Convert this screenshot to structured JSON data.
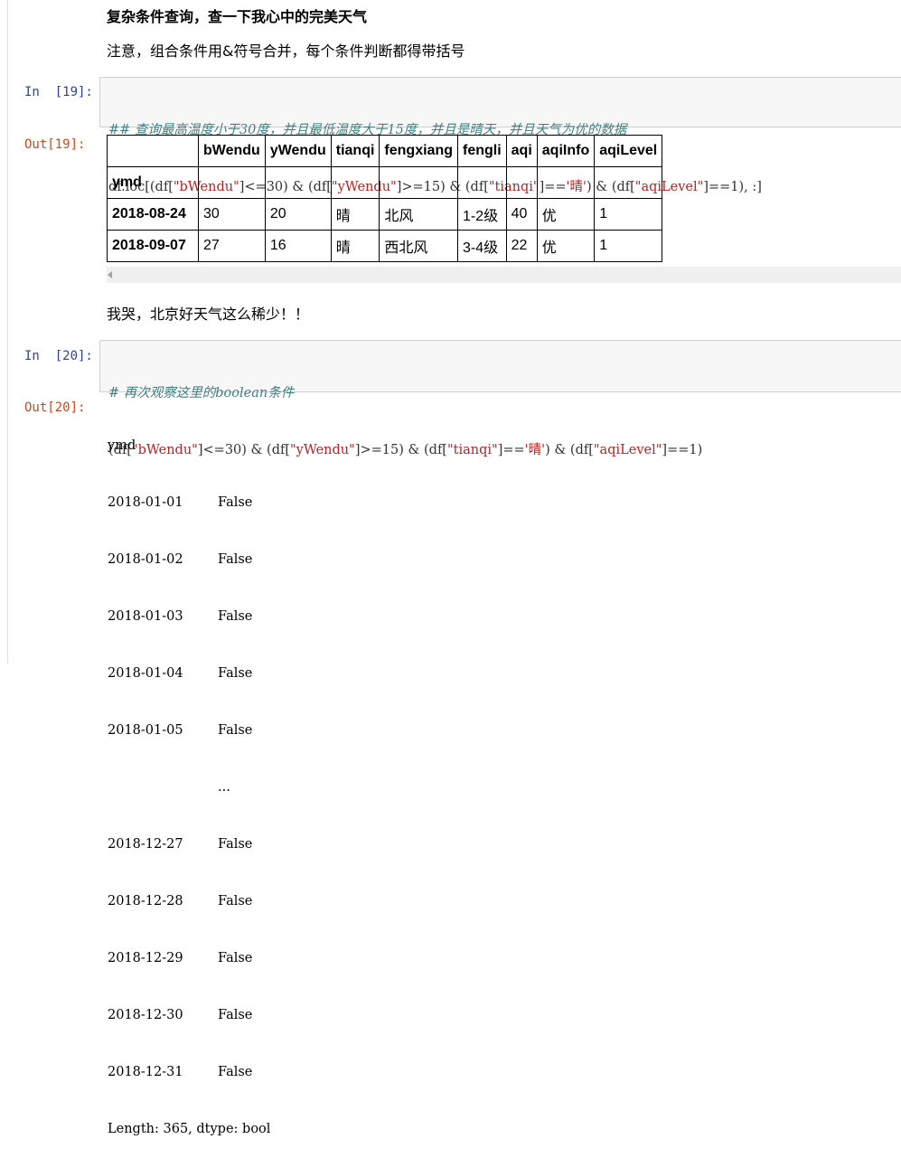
{
  "markdown_1": {
    "heading": "复杂条件查询，查一下我心中的完美天气",
    "note": "注意，组合条件用&符号合并，每个条件判断都得带括号"
  },
  "cell_19": {
    "in_prompt": "In  [19]:",
    "out_prompt": "Out[19]:",
    "comment": "## 查询最高温度小于30度，并且最低温度大于15度，并且是晴天，并且天气为优的数据",
    "code_parts": [
      "df.loc[(df[",
      "\"bWendu\"",
      "]<=30) & (df[",
      "\"yWendu\"",
      "]>=15) & (df[",
      "\"tianqi\"",
      "]==",
      "'晴'",
      ") & (df[",
      "\"aqiLevel\"",
      "]==1), :]"
    ]
  },
  "table": {
    "columns": [
      "bWendu",
      "yWendu",
      "tianqi",
      "fengxiang",
      "fengli",
      "aqi",
      "aqiInfo",
      "aqiLevel"
    ],
    "index_name": "ymd",
    "rows": [
      {
        "index": "2018-08-24",
        "values": [
          "30",
          "20",
          "晴",
          "北风",
          "1-2级",
          "40",
          "优",
          "1"
        ]
      },
      {
        "index": "2018-09-07",
        "values": [
          "27",
          "16",
          "晴",
          "西北风",
          "3-4级",
          "22",
          "优",
          "1"
        ]
      }
    ]
  },
  "markdown_2": {
    "text": "我哭，北京好天气这么稀少！！"
  },
  "cell_20": {
    "in_prompt": "In  [20]:",
    "out_prompt": "Out[20]:",
    "comment": "# 再次观察这里的boolean条件",
    "code_parts": [
      "(df[",
      "\"bWendu\"",
      "]<=30) & (df[",
      "\"yWendu\"",
      "]>=15) & (df[",
      "\"tianqi\"",
      "]==",
      "'晴'",
      ") & (df[",
      "\"aqiLevel\"",
      "]==1)"
    ]
  },
  "series_output": {
    "header": "ymd",
    "rows": [
      {
        "index": "2018-01-01",
        "value": "False"
      },
      {
        "index": "2018-01-02",
        "value": "False"
      },
      {
        "index": "2018-01-03",
        "value": "False"
      },
      {
        "index": "2018-01-04",
        "value": "False"
      },
      {
        "index": "2018-01-05",
        "value": "False"
      },
      {
        "index": "",
        "value": "..."
      },
      {
        "index": "2018-12-27",
        "value": "False"
      },
      {
        "index": "2018-12-28",
        "value": "False"
      },
      {
        "index": "2018-12-29",
        "value": "False"
      },
      {
        "index": "2018-12-30",
        "value": "False"
      },
      {
        "index": "2018-12-31",
        "value": "False"
      }
    ],
    "footer": "Length: 365, dtype: bool"
  }
}
